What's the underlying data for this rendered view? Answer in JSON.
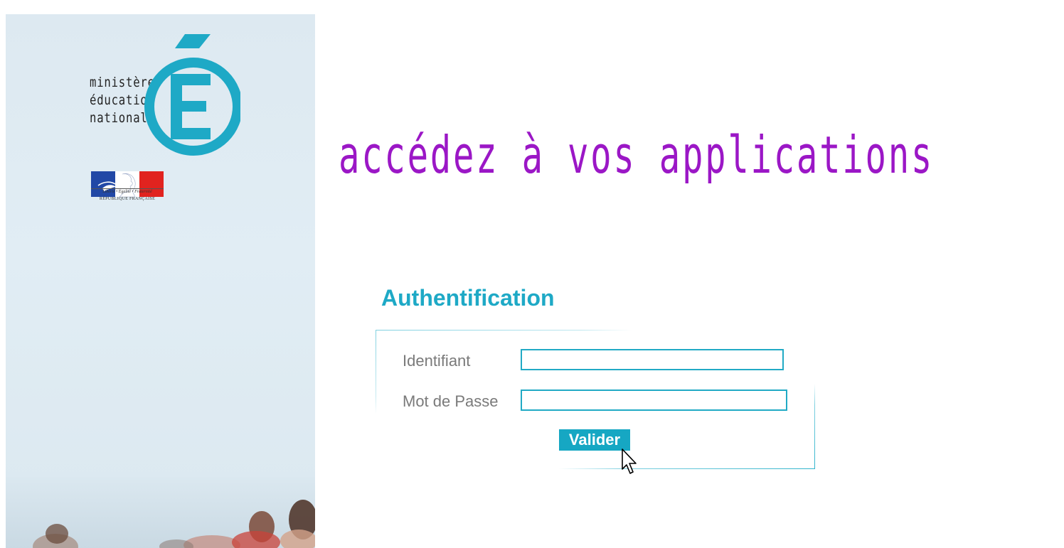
{
  "sidebar": {
    "logo_lines": [
      "ministère",
      "éducation",
      "nationale"
    ],
    "logo_letter": "É",
    "rf_motto": "Liberté • Égalité • Fraternité",
    "rf_name": "RÉPUBLIQUE FRANÇAISE"
  },
  "header": {
    "title": "accédez à vos applications"
  },
  "auth": {
    "heading": "Authentification",
    "username_label": "Identifiant",
    "username_value": "",
    "password_label": "Mot de Passe",
    "password_value": "",
    "submit_label": "Valider"
  },
  "colors": {
    "title": "#9b17c6",
    "accent": "#1ea9c6",
    "sidebar_bg": "#dde9f1",
    "label": "#7a7a7a"
  },
  "icons": {
    "logo": "men-e-logo",
    "republic": "marianne-logo",
    "pointer": "mouse-cursor-icon"
  }
}
